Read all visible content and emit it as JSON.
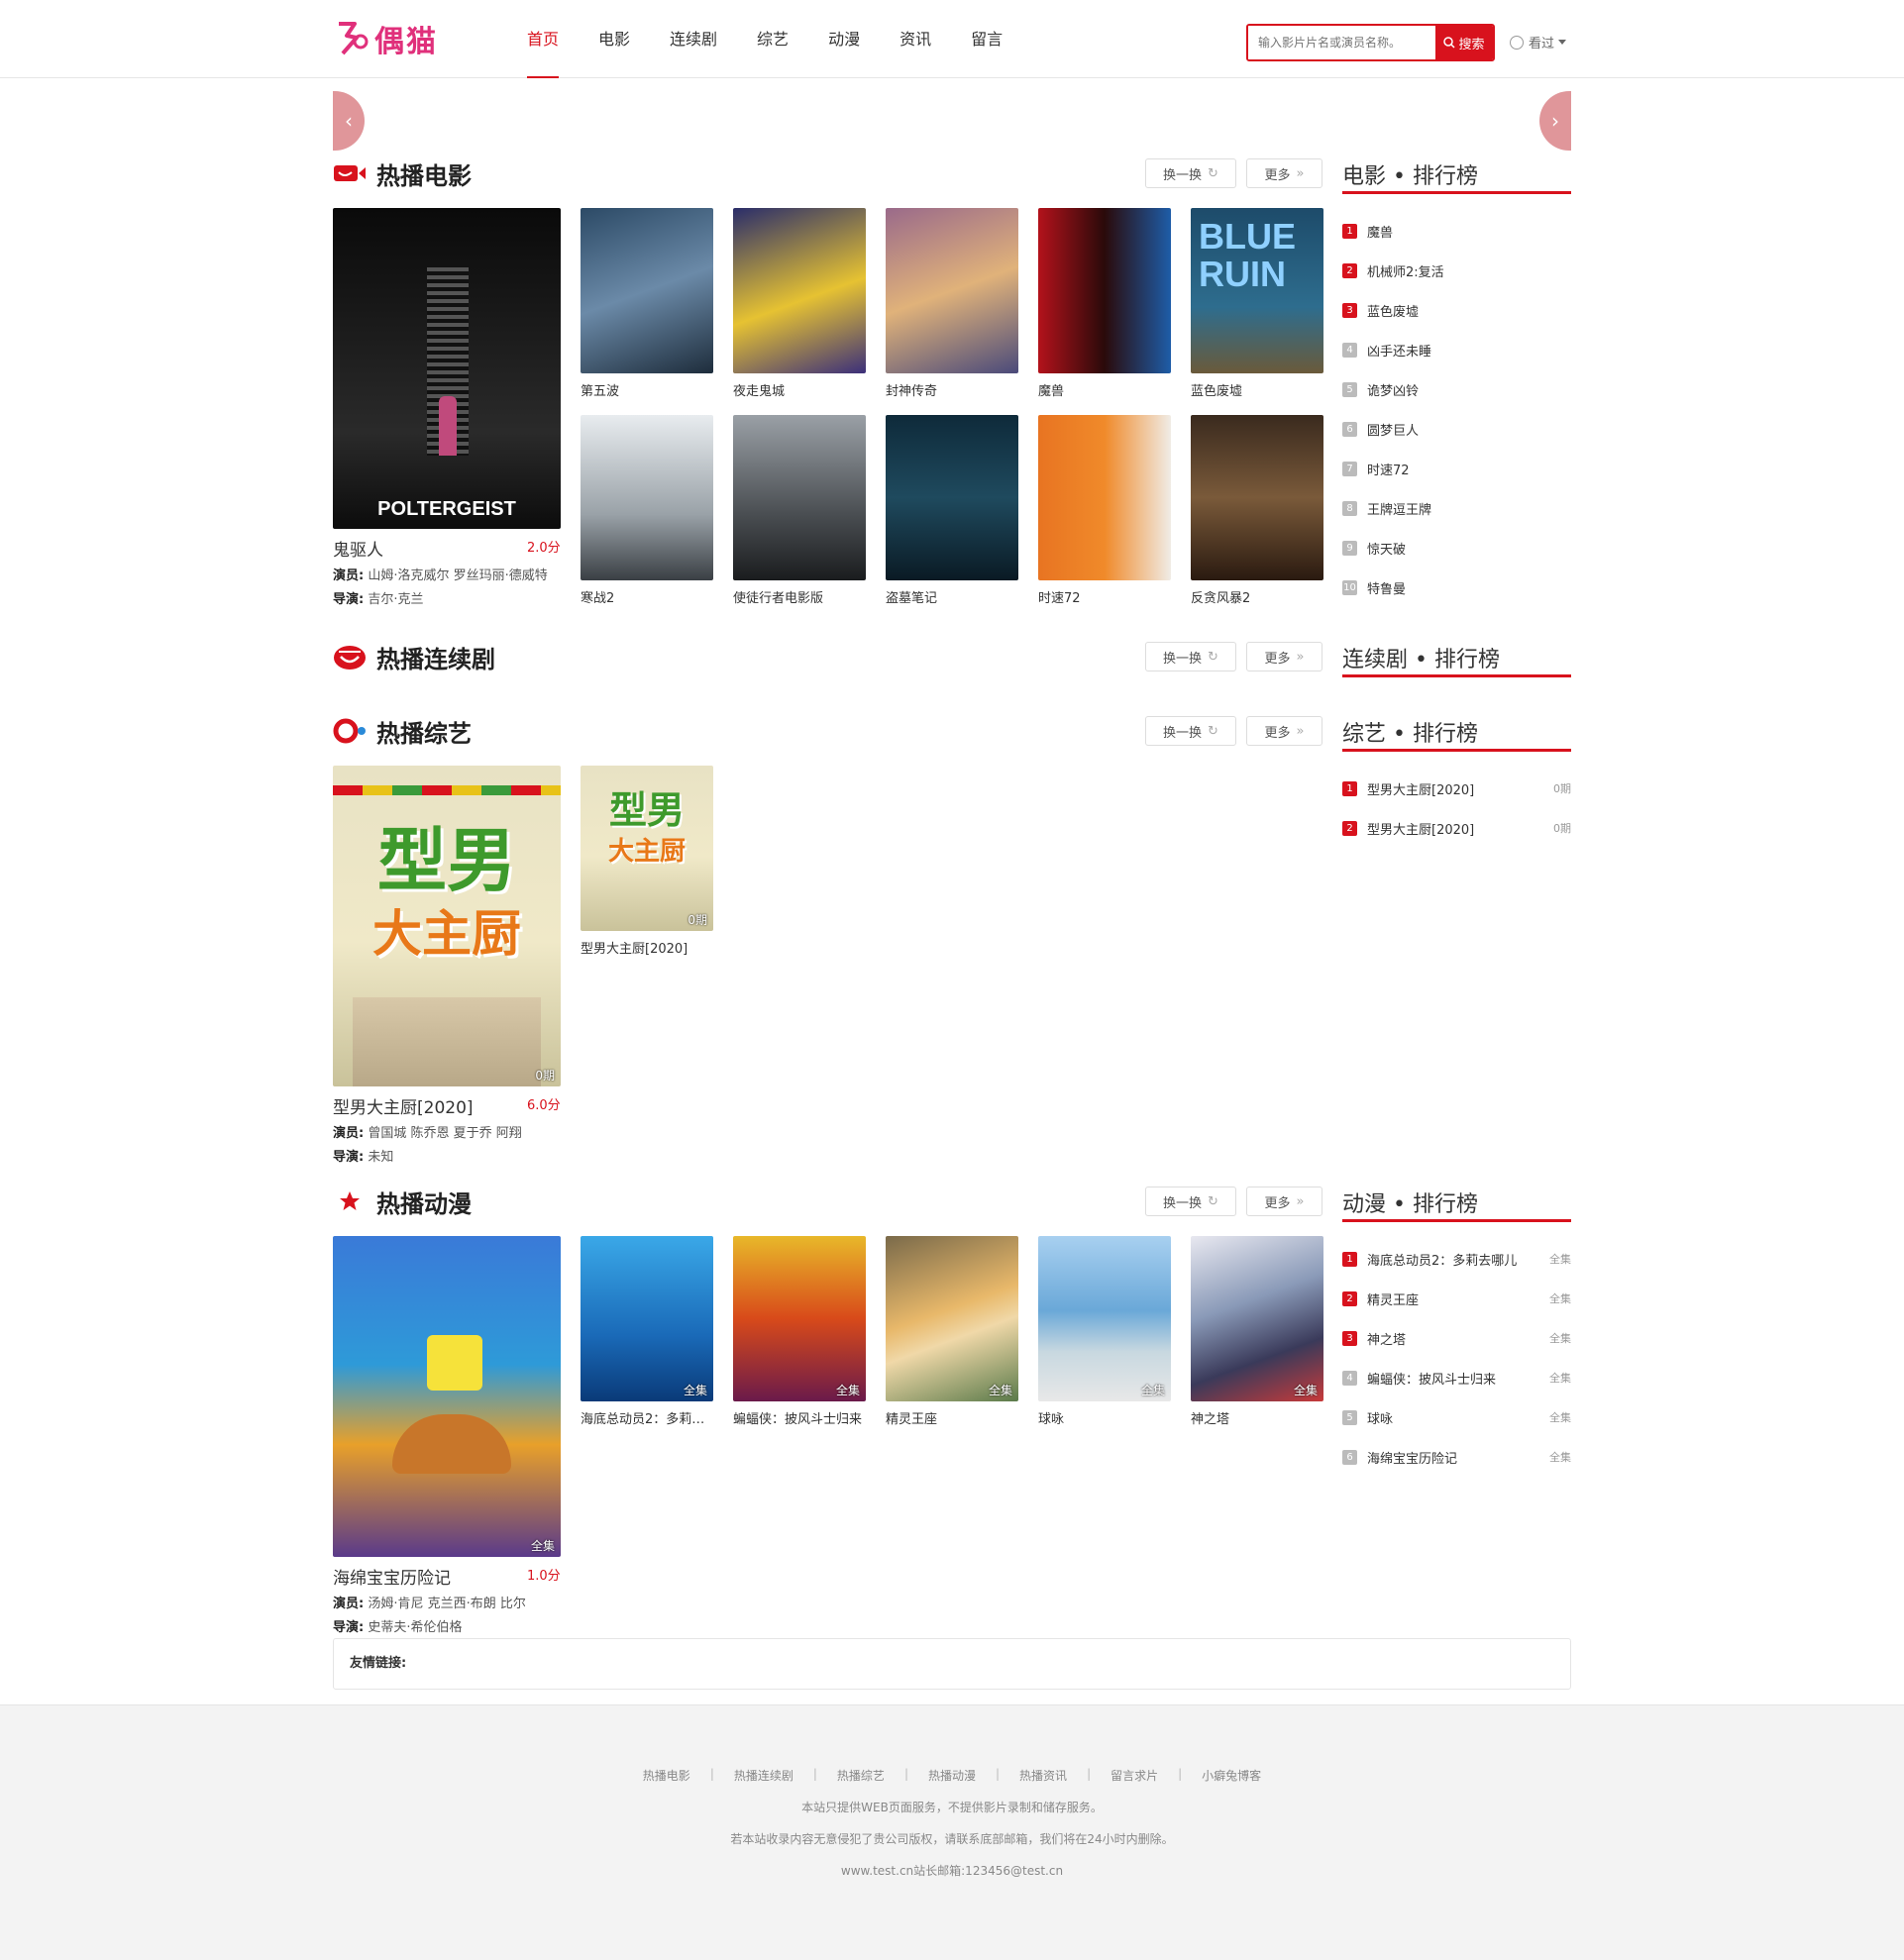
{
  "header": {
    "logo_text": "偶猫",
    "nav": [
      "首页",
      "电影",
      "连续剧",
      "综艺",
      "动漫",
      "资讯",
      "留言"
    ],
    "search_placeholder": "输入影片片名或演员名称。",
    "search_button": "搜索",
    "history_label": "看过"
  },
  "sections": {
    "movie": {
      "title": "热播电影",
      "swap_label": "换一换",
      "more_label": "更多",
      "rank_title": "电影 • 排行榜",
      "featured": {
        "name": "鬼驱人",
        "score": "2.0分",
        "actors_label": "演员:",
        "actors": "山姆·洛克威尔  罗丝玛丽·德威特",
        "director_label": "导演:",
        "director": "吉尔·克兰",
        "poster_text": "POLTERGEIST"
      },
      "items": [
        {
          "name": "第五波"
        },
        {
          "name": "夜走鬼城"
        },
        {
          "name": "封神传奇"
        },
        {
          "name": "魔兽"
        },
        {
          "name": "蓝色废墟"
        },
        {
          "name": "寒战2"
        },
        {
          "name": "使徒行者电影版"
        },
        {
          "name": "盗墓笔记"
        },
        {
          "name": "时速72"
        },
        {
          "name": "反贪风暴2"
        }
      ],
      "ranking": [
        {
          "num": "1",
          "name": "魔兽"
        },
        {
          "num": "2",
          "name": "机械师2:复活"
        },
        {
          "num": "3",
          "name": "蓝色废墟"
        },
        {
          "num": "4",
          "name": "凶手还未睡"
        },
        {
          "num": "5",
          "name": "诡梦凶铃"
        },
        {
          "num": "6",
          "name": "圆梦巨人"
        },
        {
          "num": "7",
          "name": "时速72"
        },
        {
          "num": "8",
          "name": "王牌逗王牌"
        },
        {
          "num": "9",
          "name": "惊天破"
        },
        {
          "num": "10",
          "name": "特鲁曼"
        }
      ]
    },
    "drama": {
      "title": "热播连续剧",
      "swap_label": "换一换",
      "more_label": "更多",
      "rank_title": "连续剧 • 排行榜"
    },
    "variety": {
      "title": "热播综艺",
      "swap_label": "换一换",
      "more_label": "更多",
      "rank_title": "综艺 • 排行榜",
      "featured": {
        "name": "型男大主厨[2020]",
        "score": "6.0分",
        "badge": "0期",
        "actors_label": "演员:",
        "actors": "曾国城  陈乔恩  夏于乔  阿翔",
        "director_label": "导演:",
        "director": "未知",
        "poster_top": "型男",
        "poster_bottom": "大主厨"
      },
      "items": [
        {
          "name": "型男大主厨[2020]",
          "badge": "0期"
        }
      ],
      "ranking": [
        {
          "num": "1",
          "name": "型男大主厨[2020]",
          "tag": "0期"
        },
        {
          "num": "2",
          "name": "型男大主厨[2020]",
          "tag": "0期"
        }
      ]
    },
    "anime": {
      "title": "热播动漫",
      "swap_label": "换一换",
      "more_label": "更多",
      "rank_title": "动漫 • 排行榜",
      "featured": {
        "name": "海绵宝宝历险记",
        "score": "1.0分",
        "badge": "全集",
        "actors_label": "演员:",
        "actors": "汤姆·肯尼  克兰西·布朗  比尔",
        "director_label": "导演:",
        "director": "史蒂夫·希伦伯格"
      },
      "items": [
        {
          "name": "海底总动员2：多莉去哪儿",
          "badge": "全集"
        },
        {
          "name": "蝙蝠侠：披风斗士归来",
          "badge": "全集"
        },
        {
          "name": "精灵王座",
          "badge": "全集"
        },
        {
          "name": "球咏",
          "badge": "全集"
        },
        {
          "name": "神之塔",
          "badge": "全集"
        }
      ],
      "ranking": [
        {
          "num": "1",
          "name": "海底总动员2：多莉去哪儿",
          "tag": "全集"
        },
        {
          "num": "2",
          "name": "精灵王座",
          "tag": "全集"
        },
        {
          "num": "3",
          "name": "神之塔",
          "tag": "全集"
        },
        {
          "num": "4",
          "name": "蝙蝠侠：披风斗士归来",
          "tag": "全集"
        },
        {
          "num": "5",
          "name": "球咏",
          "tag": "全集"
        },
        {
          "num": "6",
          "name": "海绵宝宝历险记",
          "tag": "全集"
        }
      ]
    }
  },
  "friend_links_label": "友情链接:",
  "footer": {
    "links": [
      "热播电影",
      "热播连续剧",
      "热播综艺",
      "热播动漫",
      "热播资讯",
      "留言求片",
      "小癖兔博客"
    ],
    "line1": "本站只提供WEB页面服务，不提供影片录制和储存服务。",
    "line2": "若本站收录内容无意侵犯了贵公司版权，请联系底部邮箱，我们将在24小时内删除。",
    "line3": "www.test.cn站长邮箱:123456@test.cn"
  },
  "colors": {
    "accent": "#d8121d",
    "logo": "#e0307b"
  }
}
